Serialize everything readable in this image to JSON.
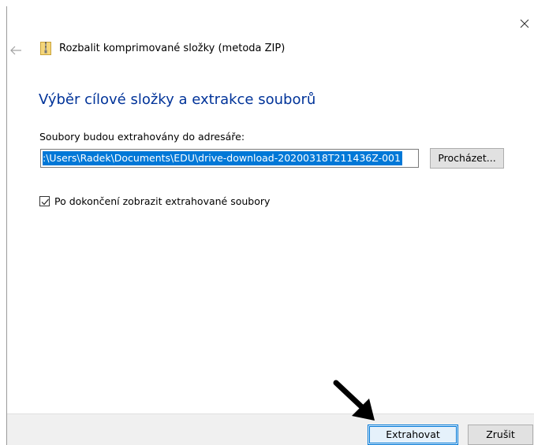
{
  "window": {
    "title": "Rozbalit komprimované složky (metoda ZIP)",
    "close_icon": "close-icon",
    "back_icon": "back-arrow-icon",
    "app_icon": "zip-folder-icon"
  },
  "main": {
    "heading": "Výběr cílové složky a extrakce souborů",
    "path_label": "Soubory budou extrahovány do adresáře:",
    "path_value": ":\\Users\\Radek\\Documents\\EDU\\drive-download-20200318T211436Z-001",
    "browse_label": "Procházet...",
    "show_files_label": "Po dokončení zobrazit extrahované soubory",
    "show_files_checked": true
  },
  "footer": {
    "extract_label": "Extrahovat",
    "cancel_label": "Zrušit"
  },
  "annotation": {
    "icon": "pointer-arrow-icon",
    "color": "#000000"
  },
  "colors": {
    "heading": "#003399",
    "selection": "#0078d7",
    "default_button_border": "#0078d7",
    "footer_bg": "#f0f0f0"
  }
}
